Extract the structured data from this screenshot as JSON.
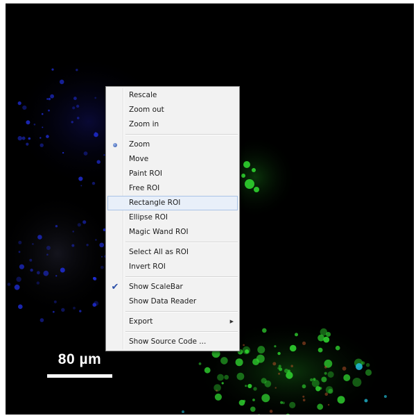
{
  "scalebar": {
    "label": "80 µm"
  },
  "menu": {
    "groups": [
      [
        {
          "label": "Rescale"
        },
        {
          "label": "Zoom out"
        },
        {
          "label": "Zoom in"
        }
      ],
      [
        {
          "label": "Zoom",
          "state": "radio-selected"
        },
        {
          "label": "Move"
        },
        {
          "label": "Paint ROI"
        },
        {
          "label": "Free ROI"
        },
        {
          "label": "Rectangle ROI",
          "state": "hovered"
        },
        {
          "label": "Ellipse ROI"
        },
        {
          "label": "Magic Wand ROI"
        }
      ],
      [
        {
          "label": "Select All as ROI"
        },
        {
          "label": "Invert ROI"
        }
      ],
      [
        {
          "label": "Show ScaleBar",
          "state": "checked"
        },
        {
          "label": "Show Data Reader"
        }
      ],
      [
        {
          "label": "Export",
          "submenu": true
        }
      ],
      [
        {
          "label": "Show Source Code ..."
        }
      ]
    ]
  },
  "colors": {
    "background": "#000000",
    "blue_channel": "#1f2dd6",
    "green_channel": "#2fd12f",
    "cyan_channel": "#1fb8d0",
    "menu_bg": "#f2f2f2",
    "menu_highlight": "#e8eff9"
  },
  "icons": {
    "radio": "radio-dot-icon",
    "check": "checkmark-icon",
    "submenu": "submenu-arrow-icon"
  }
}
